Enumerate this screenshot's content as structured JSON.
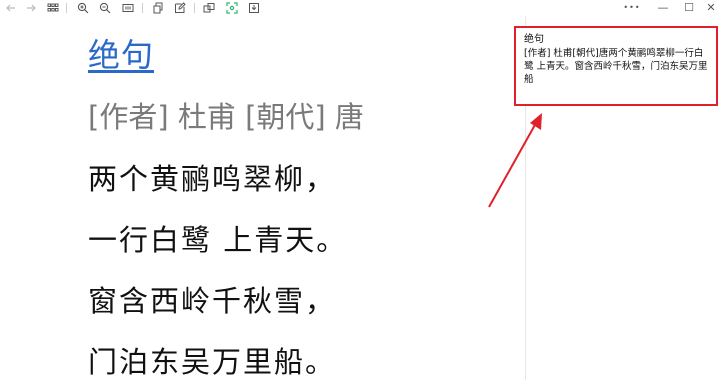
{
  "toolbar": {
    "left_icons": [
      "back-arrow-icon",
      "forward-arrow-icon",
      "grid-icon",
      "zoom-in-icon",
      "zoom-out-icon",
      "fit-page-icon",
      "copy-icon",
      "edit-icon",
      "duplicate-icon",
      "scan-icon",
      "save-icon"
    ],
    "window_controls": {
      "more": "•••",
      "minimize": "—",
      "maximize": "☐",
      "close": "✕"
    }
  },
  "document": {
    "title": "绝句",
    "meta": "[作者] 杜甫 [朝代] 唐",
    "lines": [
      "两个黄鹂鸣翠柳，",
      "一行白鹭 上青天。",
      "窗含西岭千秋雪，",
      "门泊东吴万里船。"
    ]
  },
  "note": {
    "title": "绝句",
    "body": "[作者] 杜甫[朝代]唐两个黄鹂鸣翠柳一行白鹭 上青天。窗含西岭千秋雪，门泊东吴万里船"
  },
  "colors": {
    "title_link": "#2a69c8",
    "annotation": "#e0202a",
    "meta_text": "#7a7a7a"
  }
}
